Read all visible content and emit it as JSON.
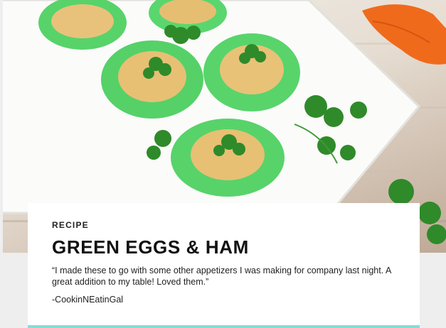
{
  "hero": {
    "image_name": "green-deviled-eggs-photo"
  },
  "card": {
    "eyebrow": "RECIPE",
    "title": "GREEN EGGS & HAM",
    "quote": "“I made these to go with some other appetizers I was making for company last night. A great addition to my table! Loved them.”",
    "author": "-CookinNEatinGal",
    "accent_color": "#86ddd6"
  }
}
